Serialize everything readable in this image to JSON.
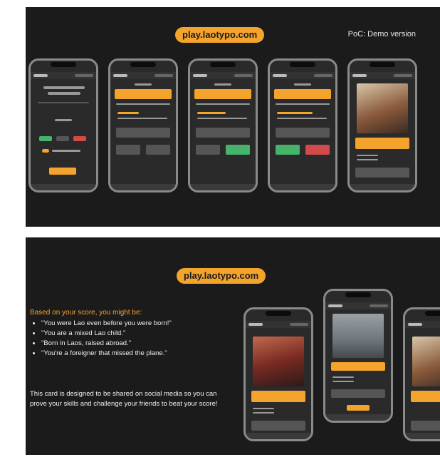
{
  "slide1": {
    "url_pill": "play.laotypo.com",
    "poc_label": "PoC: Demo version",
    "phones": [
      {
        "screen": "start"
      },
      {
        "screen": "question-pending"
      },
      {
        "screen": "question-correct"
      },
      {
        "screen": "question-feedback"
      },
      {
        "screen": "result-card"
      }
    ]
  },
  "slide2": {
    "url_pill": "play.laotypo.com",
    "score_heading": "Based on your score, you might be:",
    "results": [
      "\"You were Lao even before you were born!\"",
      "\"You are a mixed Lao child.\"",
      "\"Born in Laos, raised abroad.\"",
      "\"You're a foreigner that missed the plane.\""
    ],
    "description": "This card is designed to be shared on social media so you can prove your skills and challenge your friends to beat your score!"
  },
  "colors": {
    "accent": "#f4a32d",
    "background": "#1b1b1b",
    "correct": "#46b36b",
    "wrong": "#d34a4a"
  }
}
